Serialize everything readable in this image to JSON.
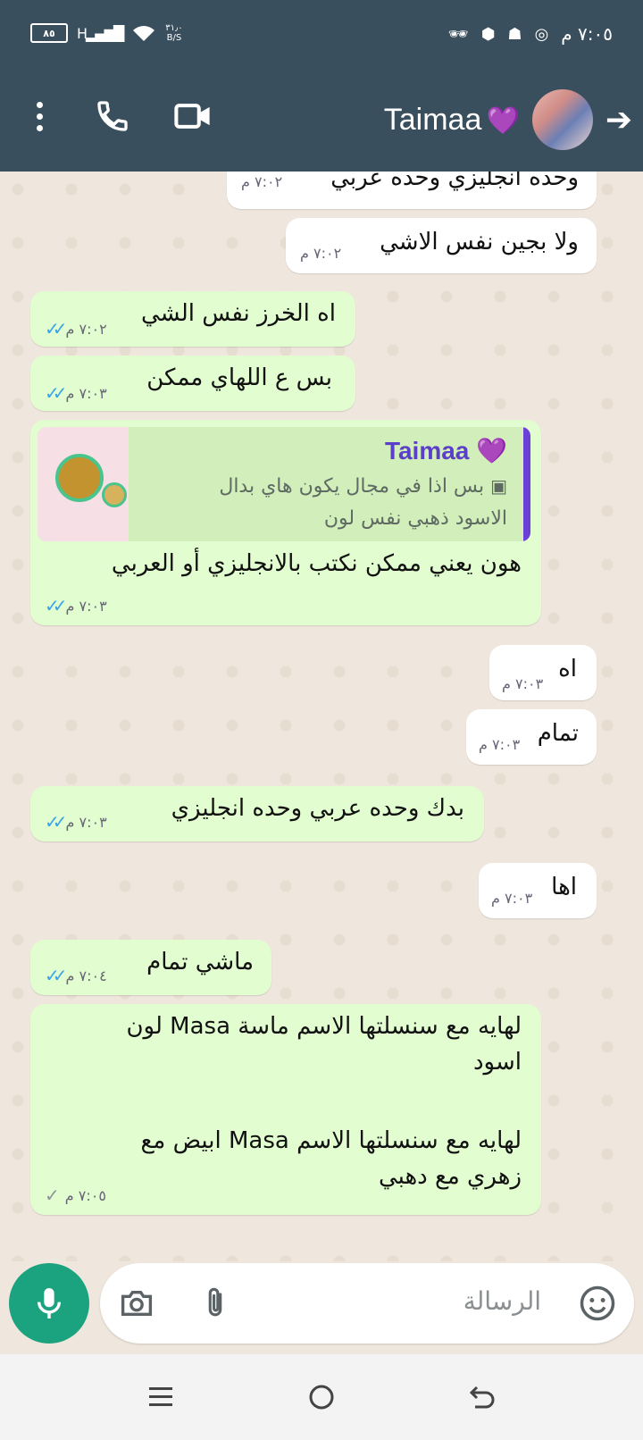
{
  "status_bar": {
    "battery": "٨٥",
    "network_type": "H",
    "speed_value": "٣١٫٠",
    "speed_unit": "B/S",
    "time": "٧:٠٥ م"
  },
  "header": {
    "contact_name": "Taimaa",
    "contact_emoji": "💜"
  },
  "messages": [
    {
      "dir": "in",
      "text": "وحده انجليزي وحده عربي",
      "time": "٧:٠٢ م"
    },
    {
      "dir": "in",
      "text": "ولا بجين نفس الاشي",
      "time": "٧:٠٢ م"
    },
    {
      "dir": "out",
      "text": "اه الخرز نفس الشي",
      "time": "٧:٠٢ م",
      "status": "read"
    },
    {
      "dir": "out",
      "text": "بس ع اللهاي ممكن",
      "time": "٧:٠٣ م",
      "status": "read"
    },
    {
      "dir": "out",
      "text": "هون يعني ممكن نكتب بالانجليزي أو العربي",
      "time": "٧:٠٣ م",
      "status": "read",
      "quote": {
        "name": "Taimaa 💜",
        "line1": "بس اذا في مجال يكون هاي بدال",
        "line2": "الاسود ذهبي نفس لون"
      }
    },
    {
      "dir": "in",
      "text": "اه",
      "time": "٧:٠٣ م"
    },
    {
      "dir": "in",
      "text": "تمام",
      "time": "٧:٠٣ م"
    },
    {
      "dir": "out",
      "text": "بدك وحده عربي وحده انجليزي",
      "time": "٧:٠٣ م",
      "status": "read"
    },
    {
      "dir": "in",
      "text": "اها",
      "time": "٧:٠٣ م"
    },
    {
      "dir": "out",
      "text": "ماشي تمام",
      "time": "٧:٠٤ م",
      "status": "read"
    },
    {
      "dir": "out",
      "lines": [
        "لهايه مع سنسلتها الاسم ماسة Masa لون",
        "اسود",
        "",
        "لهايه مع سنسلتها الاسم Masa ابيض مع",
        "زهري مع دهبي"
      ],
      "time": "٧:٠٥ م",
      "status": "sent"
    }
  ],
  "input": {
    "placeholder": "الرسالة"
  },
  "colors": {
    "header": "#3a4f5d",
    "outgoing_bubble": "#e2fdcf",
    "incoming_bubble": "#ffffff",
    "mic_button": "#1aa37e",
    "read_ticks": "#3ba3e8",
    "quote_accent": "#6b40d6"
  },
  "icons": [
    "kebab-menu-icon",
    "phone-icon",
    "video-call-icon",
    "back-arrow-icon",
    "mic-icon",
    "camera-icon",
    "attach-icon",
    "emoji-icon",
    "recents-icon",
    "home-icon",
    "back-nav-icon"
  ]
}
